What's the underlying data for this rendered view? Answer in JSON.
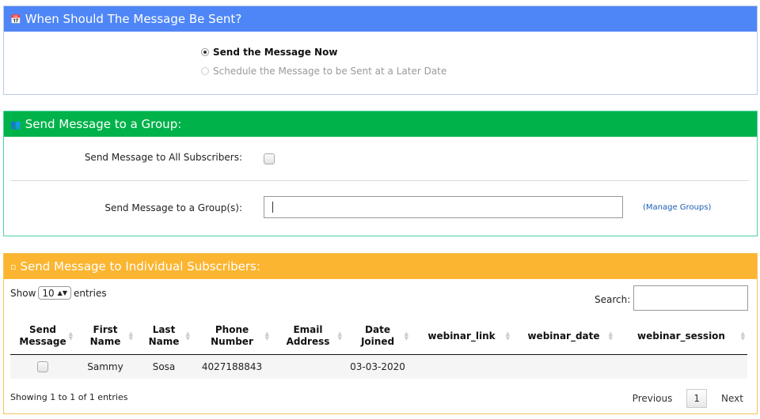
{
  "send_time": {
    "title": "When Should The Message Be Sent?",
    "icon": "calendar-icon",
    "color": "#4f86f7",
    "options": [
      {
        "label": "Send the Message Now",
        "selected": true
      },
      {
        "label": "Schedule the Message to be Sent at a Later Date",
        "selected": false
      }
    ]
  },
  "group": {
    "title": "Send Message to a Group:",
    "icon": "group-icon",
    "color": "#00b24a",
    "all_label": "Send Message to All Subscribers:",
    "group_label": "Send Message to a Group(s):",
    "group_value": "",
    "manage_link": "(Manage Groups)"
  },
  "individual": {
    "title": "Send Message to Individual Subscribers:",
    "icon": "square-icon",
    "color": "#fbb530",
    "show_label": "Show",
    "entries_value": "10",
    "entries_label": "entries",
    "search_label": "Search:",
    "columns": [
      "Send Message",
      "First Name",
      "Last Name",
      "Phone Number",
      "Email Address",
      "Date Joined",
      "webinar_link",
      "webinar_date",
      "webinar_session"
    ],
    "rows": [
      {
        "first_name": "Sammy",
        "last_name": "Sosa",
        "phone": "4027188843",
        "email": "",
        "date_joined": "03-03-2020",
        "webinar_link": "",
        "webinar_date": "",
        "webinar_session": ""
      }
    ],
    "info": "Showing 1 to 1 of 1 entries",
    "pager": {
      "previous": "Previous",
      "current": "1",
      "next": "Next"
    }
  }
}
